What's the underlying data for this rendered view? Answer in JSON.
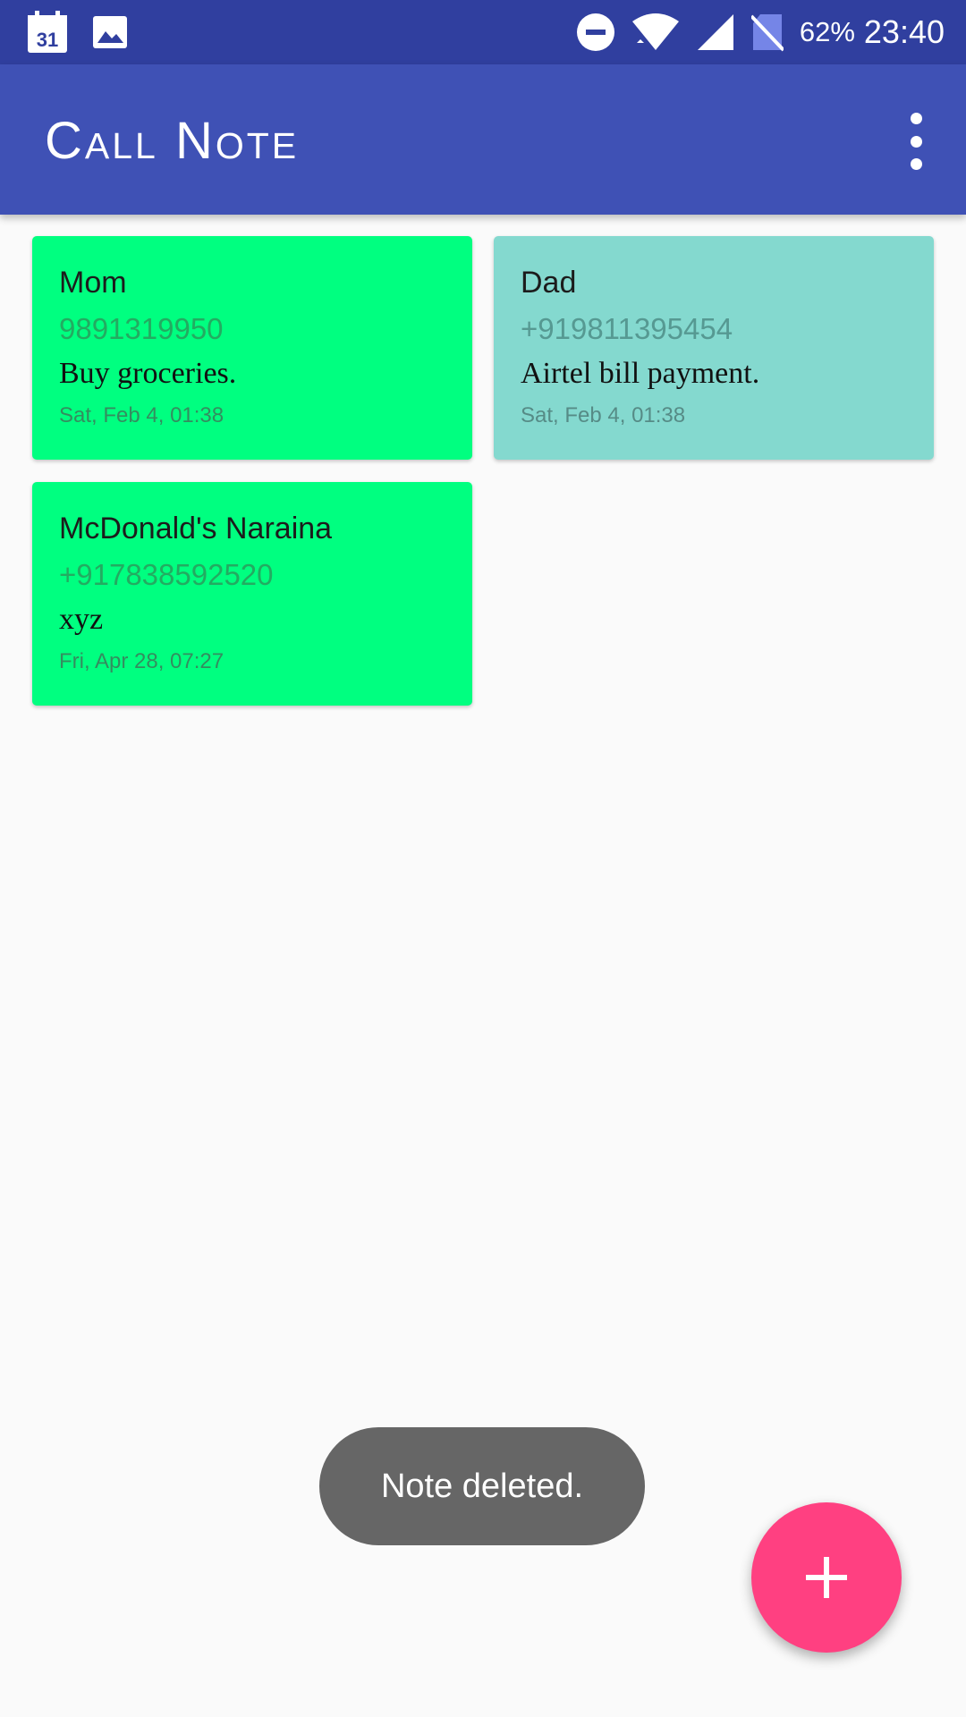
{
  "status_bar": {
    "battery": "62%",
    "time": "23:40",
    "calendar_day": "31",
    "icons": [
      "calendar-icon",
      "image-icon",
      "do-not-disturb-icon",
      "wifi-icon",
      "signal-icon",
      "no-sim-icon"
    ]
  },
  "app_bar": {
    "title": "Call Note",
    "menu_icon": "more-vert-icon"
  },
  "notes": [
    {
      "name": "Mom",
      "phone": "9891319950",
      "text": "Buy groceries.",
      "date": "Sat, Feb 4, 01:38",
      "color": "#00ff80"
    },
    {
      "name": "Dad",
      "phone": "+919811395454",
      "text": "Airtel bill payment.",
      "date": "Sat, Feb 4, 01:38",
      "color": "#84d9cf"
    },
    {
      "name": "McDonald's Naraina",
      "phone": "+917838592520",
      "text": "xyz",
      "date": "Fri, Apr 28, 07:27",
      "color": "#00ff80"
    }
  ],
  "toast": {
    "message": "Note deleted."
  },
  "fab": {
    "icon": "add-icon",
    "color": "#ff4081"
  },
  "colors": {
    "status_bar": "#303f9f",
    "app_bar": "#3f51b5",
    "background": "#fafafa"
  }
}
